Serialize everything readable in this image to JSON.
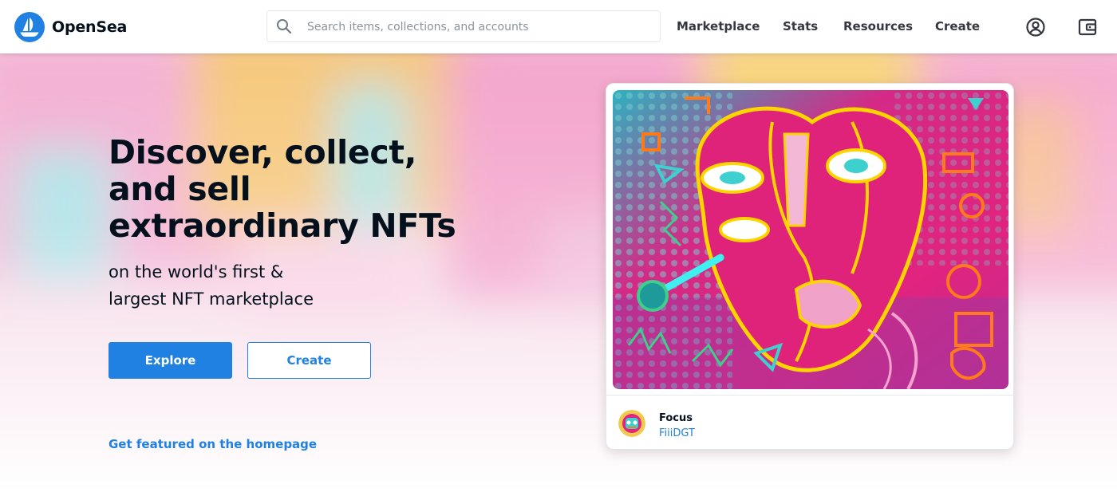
{
  "brand": {
    "name": "OpenSea",
    "accent": "#2081e2"
  },
  "search": {
    "placeholder": "Search items, collections, and accounts",
    "value": "",
    "icon": "search-icon"
  },
  "nav": {
    "links": [
      "Marketplace",
      "Stats",
      "Resources",
      "Create"
    ],
    "icons": [
      "account-icon",
      "wallet-icon"
    ]
  },
  "hero": {
    "title": "Discover, collect, and sell extraordinary NFTs",
    "subtitle_line1": "on the world's first &",
    "subtitle_line2": "largest NFT marketplace",
    "explore_label": "Explore",
    "create_label": "Create",
    "featured_link": "Get featured on the homepage"
  },
  "featured_card": {
    "name": "Focus",
    "creator": "FiiiDGT"
  },
  "colors": {
    "text": "#04111d",
    "nav_text": "#353840",
    "art_magenta": "#e0247f",
    "art_yellow": "#ffd400",
    "art_teal": "#3ecfcf",
    "art_orange": "#ff7a1a"
  }
}
